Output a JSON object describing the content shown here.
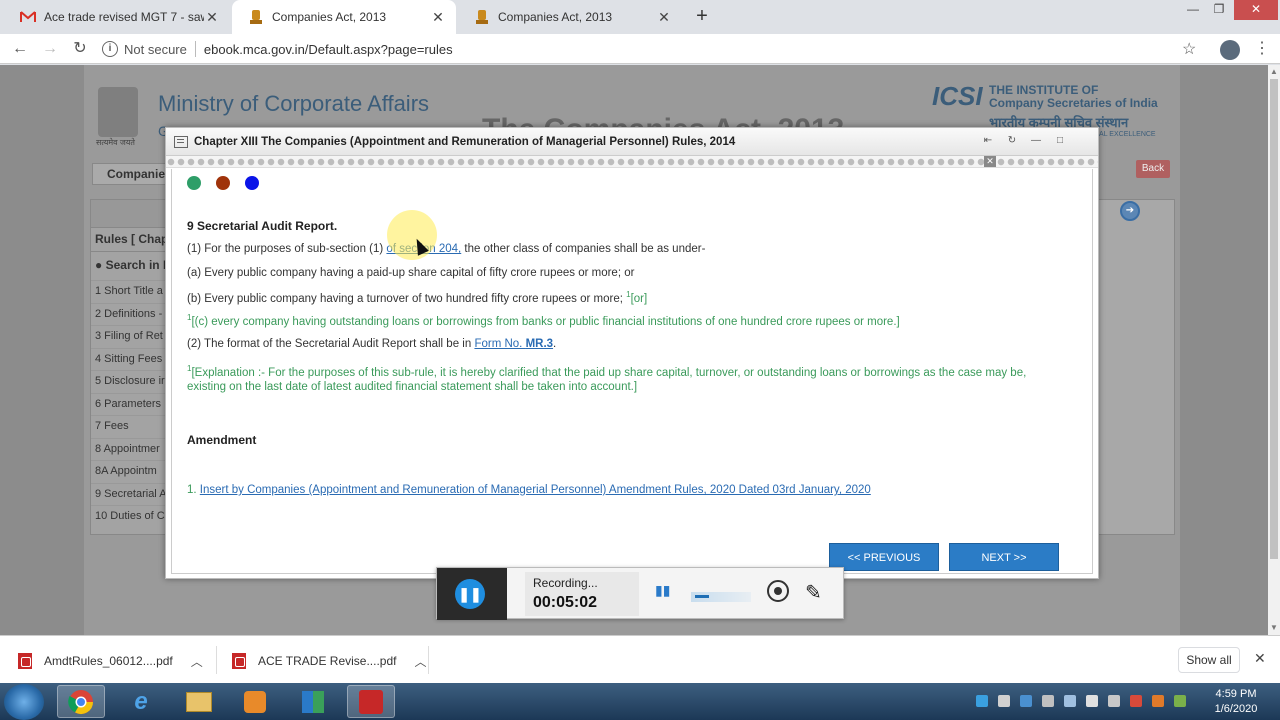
{
  "browser": {
    "tabs": [
      {
        "title": "Ace trade revised MGT 7 - sawhr",
        "icon": "gmail-icon"
      },
      {
        "title": "Companies Act, 2013",
        "icon": "emblem-icon"
      },
      {
        "title": "Companies Act, 2013",
        "icon": "emblem-icon"
      }
    ],
    "security": "Not secure",
    "url": "ebook.mca.gov.in/Default.aspx?page=rules"
  },
  "site": {
    "emblem_caption": "सत्यमेव जयते",
    "ministry": "Ministry of Corporate Affairs",
    "ministry_sub": "G",
    "big_title": "The Companies Act, 2013",
    "icsi_logo": "ICSI",
    "icsi_name_1": "THE INSTITUTE OF",
    "icsi_name_2": "Company Secretaries of India",
    "icsi_hindi": "भारतीय कम्पनी सचिव संस्थान",
    "icsi_motto": "NAL EXCELLENCE",
    "tab_label": "Companies",
    "back_label": "Back",
    "rules_header": "Rules [ Chapt",
    "search_label": "Search in R",
    "rules_list": [
      "1 Short Title a",
      "2 Definitions -",
      "3 Filing of Ret",
      "4 Sitting Fees",
      "5 Disclosure ir",
      "6 Parameters",
      "7 Fees",
      "8 Appointmer",
      "8A Appointm",
      "9 Secretarial A",
      "10 Duties of C"
    ]
  },
  "modal": {
    "title": "Chapter XIII The Companies (Appointment and Remuneration of Managerial Personnel) Rules, 2014",
    "dot_colors": [
      "#2e9e68",
      "#a0330a",
      "#0a14e8"
    ],
    "section_title": "9 Secretarial Audit Report.",
    "line1_pre": "(1) For the purposes of sub-section (1) ",
    "line1_link": "of section 204,",
    "line1_post": " the other class of companies shall be as under-",
    "line2": "(a) Every public company having a paid-up share capital of fifty crore rupees or more; or",
    "line3": "(b) Every public company having a turnover of two hundred fifty crore rupees or more; ",
    "line3_sup": "1",
    "line3_or": "[or]",
    "line4_sup": "1",
    "line4": "[(c)  every company having outstanding loans or borrowings from banks or public financial institutions of one hundred crore rupees or more.]",
    "line5_pre": "(2) The format of the Secretarial Audit Report shall be in ",
    "line5_link1": "Form No. ",
    "line5_link2": "MR.3",
    "line5_post": ".",
    "expl_sup": "1",
    "explanation_1": "[Explanation :- For the purposes of this sub-rule, it is hereby clarified that the paid up share capital, turnover, or outstanding loans or borrowings as the case may be,",
    "explanation_2": "existing on the last date of latest audited financial statement shall be taken into account.]",
    "amendment_heading": "Amendment",
    "amendment_num": "1. ",
    "amendment_link": "Insert by Companies (Appointment and Remuneration of Managerial Personnel) Amendment Rules, 2020 Dated 03rd January, 2020",
    "prev_label": "<< PREVIOUS",
    "next_label": "NEXT >>"
  },
  "recorder": {
    "status": "Recording...",
    "elapsed": "00:05:02"
  },
  "downloads": [
    {
      "name": "AmdtRules_06012....pdf"
    },
    {
      "name": "ACE TRADE Revise....pdf"
    }
  ],
  "show_all": "Show all",
  "clock": {
    "time": "4:59 PM",
    "date": "1/6/2020"
  }
}
